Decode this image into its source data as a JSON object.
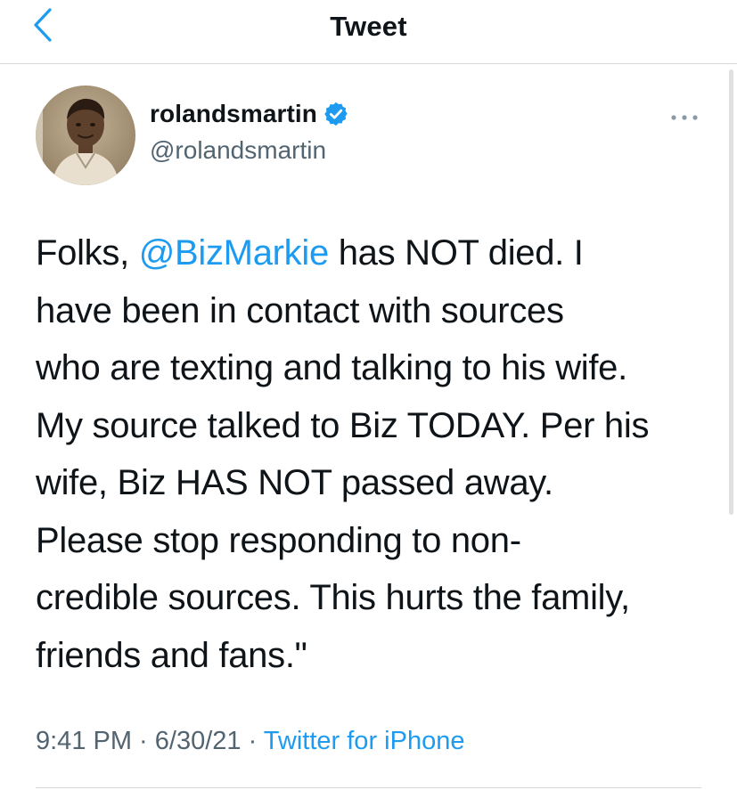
{
  "header": {
    "title": "Tweet",
    "back_icon": "chevron-left-icon"
  },
  "author": {
    "display_name": "rolandsmartin",
    "handle": "@rolandsmartin",
    "verified": true,
    "verified_icon": "verified-badge-icon"
  },
  "more_icon": "more-horizontal-icon",
  "tweet": {
    "lines": [
      {
        "pre": "Folks, ",
        "mention": "@BizMarkie",
        "post": " has NOT died. I"
      },
      {
        "text": "have been in contact with sources"
      },
      {
        "text": "who are texting and talking to his wife."
      },
      {
        "text": "My source talked to Biz TODAY. Per his"
      },
      {
        "text": "wife, Biz HAS NOT passed away."
      },
      {
        "text": "Please stop responding to non-"
      },
      {
        "text": "credible sources. This hurts the family,"
      },
      {
        "text": "friends and fans.\""
      }
    ]
  },
  "meta": {
    "time": "9:41 PM",
    "date": "6/30/21",
    "separator": " · ",
    "source": "Twitter for iPhone"
  },
  "colors": {
    "link": "#1d9bf0",
    "secondary_text": "#536471",
    "divider": "#d6d9db"
  }
}
